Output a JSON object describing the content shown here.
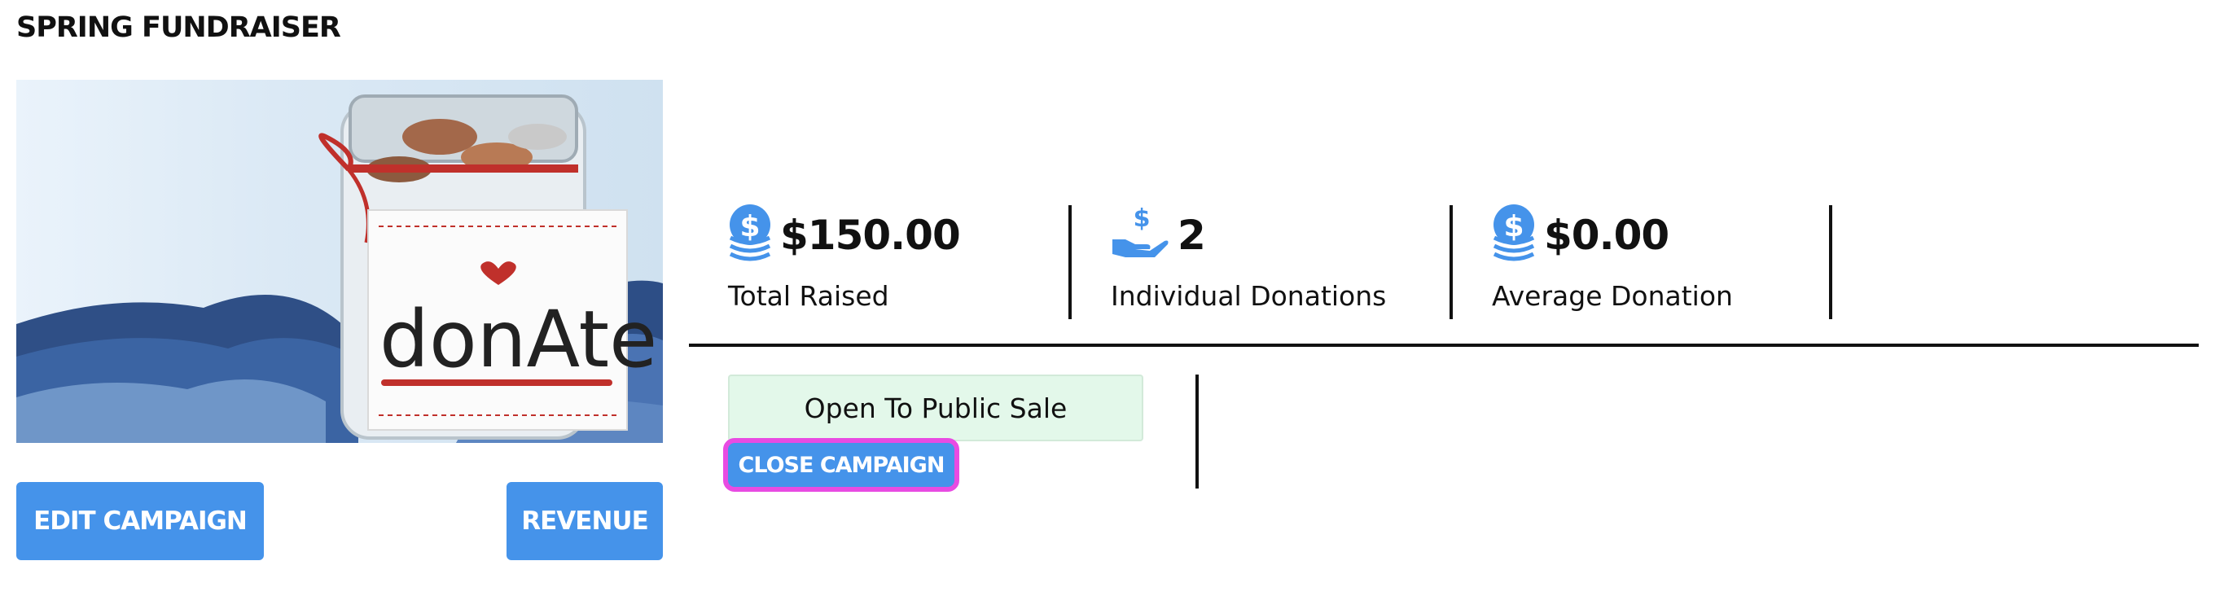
{
  "page": {
    "title": "SPRING FUNDRAISER"
  },
  "image": {
    "jar_text": "donAte"
  },
  "actions": {
    "edit_label": "EDIT CAMPAIGN",
    "revenue_label": "REVENUE"
  },
  "stats": [
    {
      "icon": "coin-stack-icon",
      "value": "$150.00",
      "label": "Total Raised"
    },
    {
      "icon": "hand-dollar-icon",
      "value": "2",
      "label": "Individual Donations"
    },
    {
      "icon": "coin-stack-icon",
      "value": "$0.00",
      "label": "Average Donation"
    }
  ],
  "status": {
    "text": "Open To Public Sale",
    "close_label": "CLOSE CAMPAIGN"
  },
  "colors": {
    "accent": "#4593ea",
    "status_bg": "#e3f8ea",
    "focus_ring": "#e84be2"
  }
}
